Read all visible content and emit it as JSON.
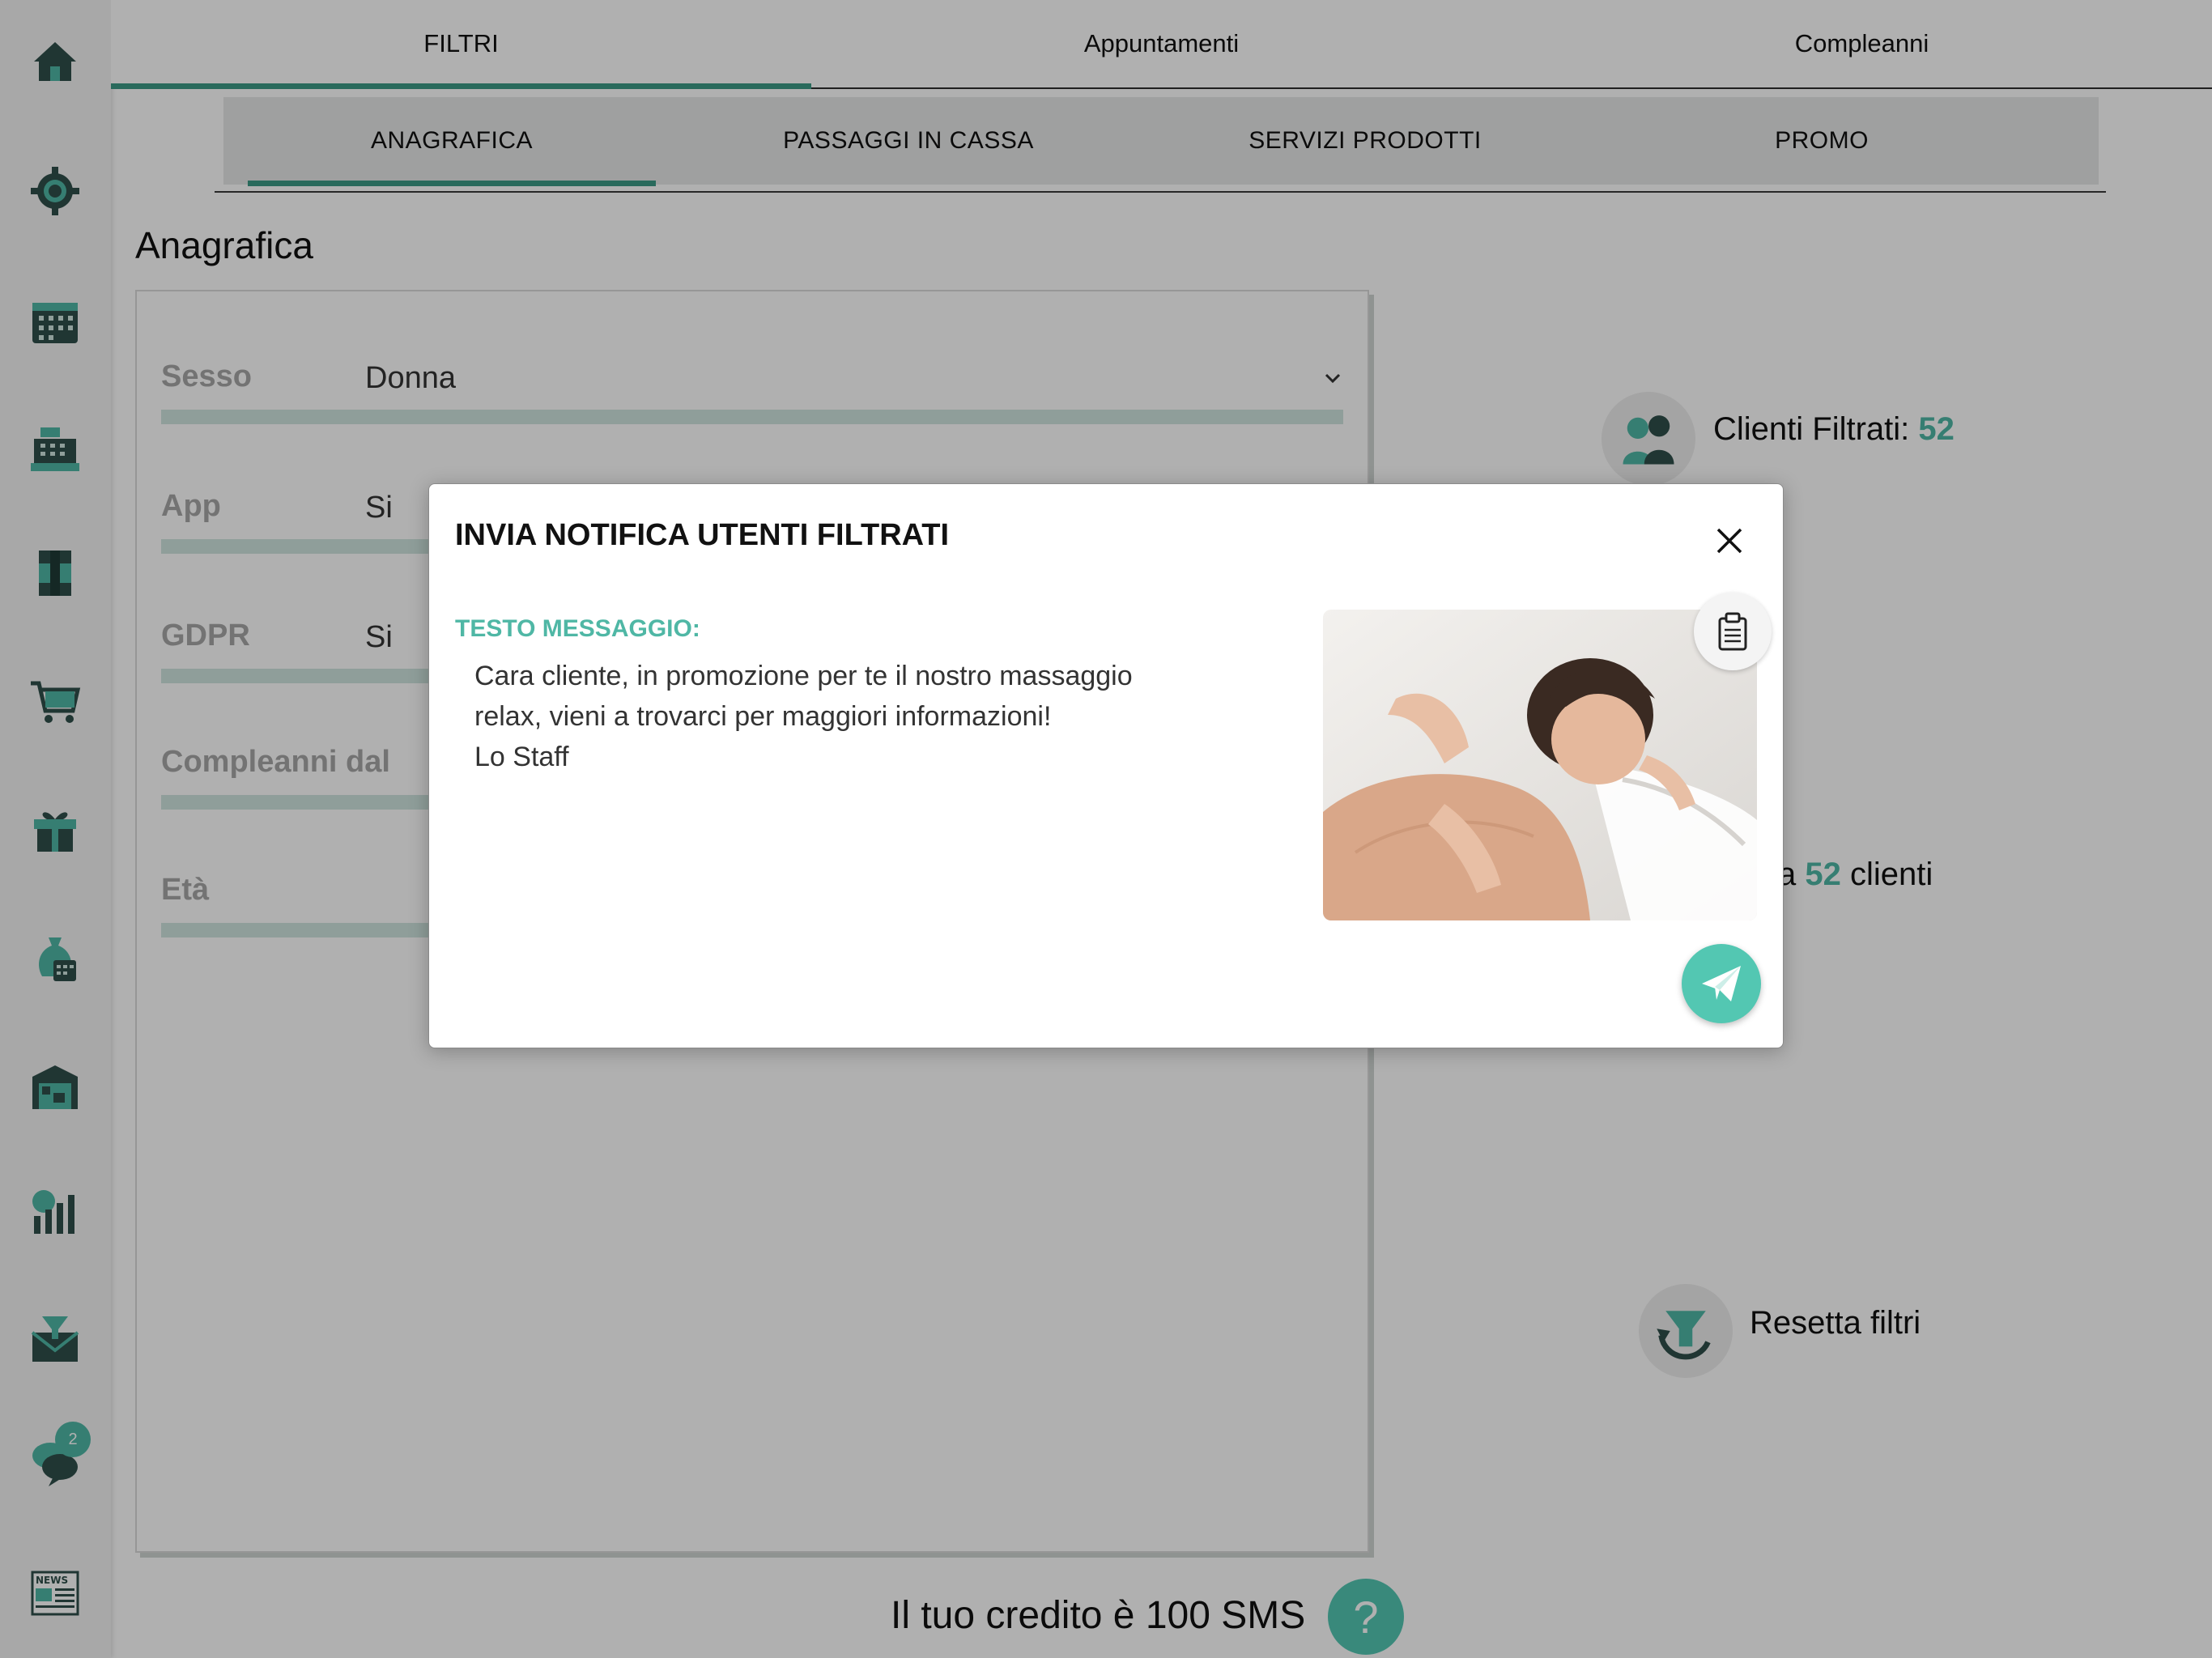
{
  "sidebar": {
    "items": [
      {
        "name": "home-icon"
      },
      {
        "name": "settings-icon"
      },
      {
        "name": "calendar-icon"
      },
      {
        "name": "cash-register-icon"
      },
      {
        "name": "products-icon"
      },
      {
        "name": "cart-icon"
      },
      {
        "name": "gift-icon"
      },
      {
        "name": "money-bag-icon"
      },
      {
        "name": "warehouse-icon"
      },
      {
        "name": "stats-icon"
      },
      {
        "name": "mail-filter-icon"
      },
      {
        "name": "chat-icon",
        "badge": "2"
      },
      {
        "name": "news-icon"
      }
    ],
    "accent_color": "#4fb7a5",
    "icon_color": "#2f4f4a"
  },
  "top_tabs": [
    {
      "label": "FILTRI",
      "active": true
    },
    {
      "label": "Appuntamenti",
      "active": false
    },
    {
      "label": "Compleanni",
      "active": false
    }
  ],
  "sub_tabs": [
    {
      "label": "ANAGRAFICA",
      "active": true
    },
    {
      "label": "PASSAGGI IN CASSA",
      "active": false
    },
    {
      "label": "SERVIZI PRODOTTI",
      "active": false
    },
    {
      "label": "PROMO",
      "active": false
    }
  ],
  "section": {
    "title": "Anagrafica",
    "filters": [
      {
        "label": "Sesso",
        "value": "Donna",
        "dropdown": true
      },
      {
        "label": "App",
        "value": "Si"
      },
      {
        "label": "GDPR",
        "value": "Si"
      },
      {
        "label": "Compleanni dal",
        "value": ""
      },
      {
        "label": "Età",
        "value": ""
      }
    ]
  },
  "right_panel": {
    "clients_filtered_label": "Clienti Filtrati:",
    "clients_filtered_count": "52",
    "send_to_prefix": "a",
    "send_to_count": "52",
    "send_to_suffix": "clienti",
    "reset_label": "Resetta filtri"
  },
  "footer": {
    "credit_text": "Il tuo credito è 100 SMS",
    "help_label": "?"
  },
  "modal": {
    "title": "INVIA NOTIFICA UTENTI FILTRATI",
    "message_label": "TESTO MESSAGGIO:",
    "message_text": "Cara cliente, in promozione per te il nostro massaggio\nrelax, vieni a trovarci per maggiori informazioni!\nLo Staff",
    "image_description_icon": "massage-photo",
    "accent_color": "#53c7b2"
  }
}
